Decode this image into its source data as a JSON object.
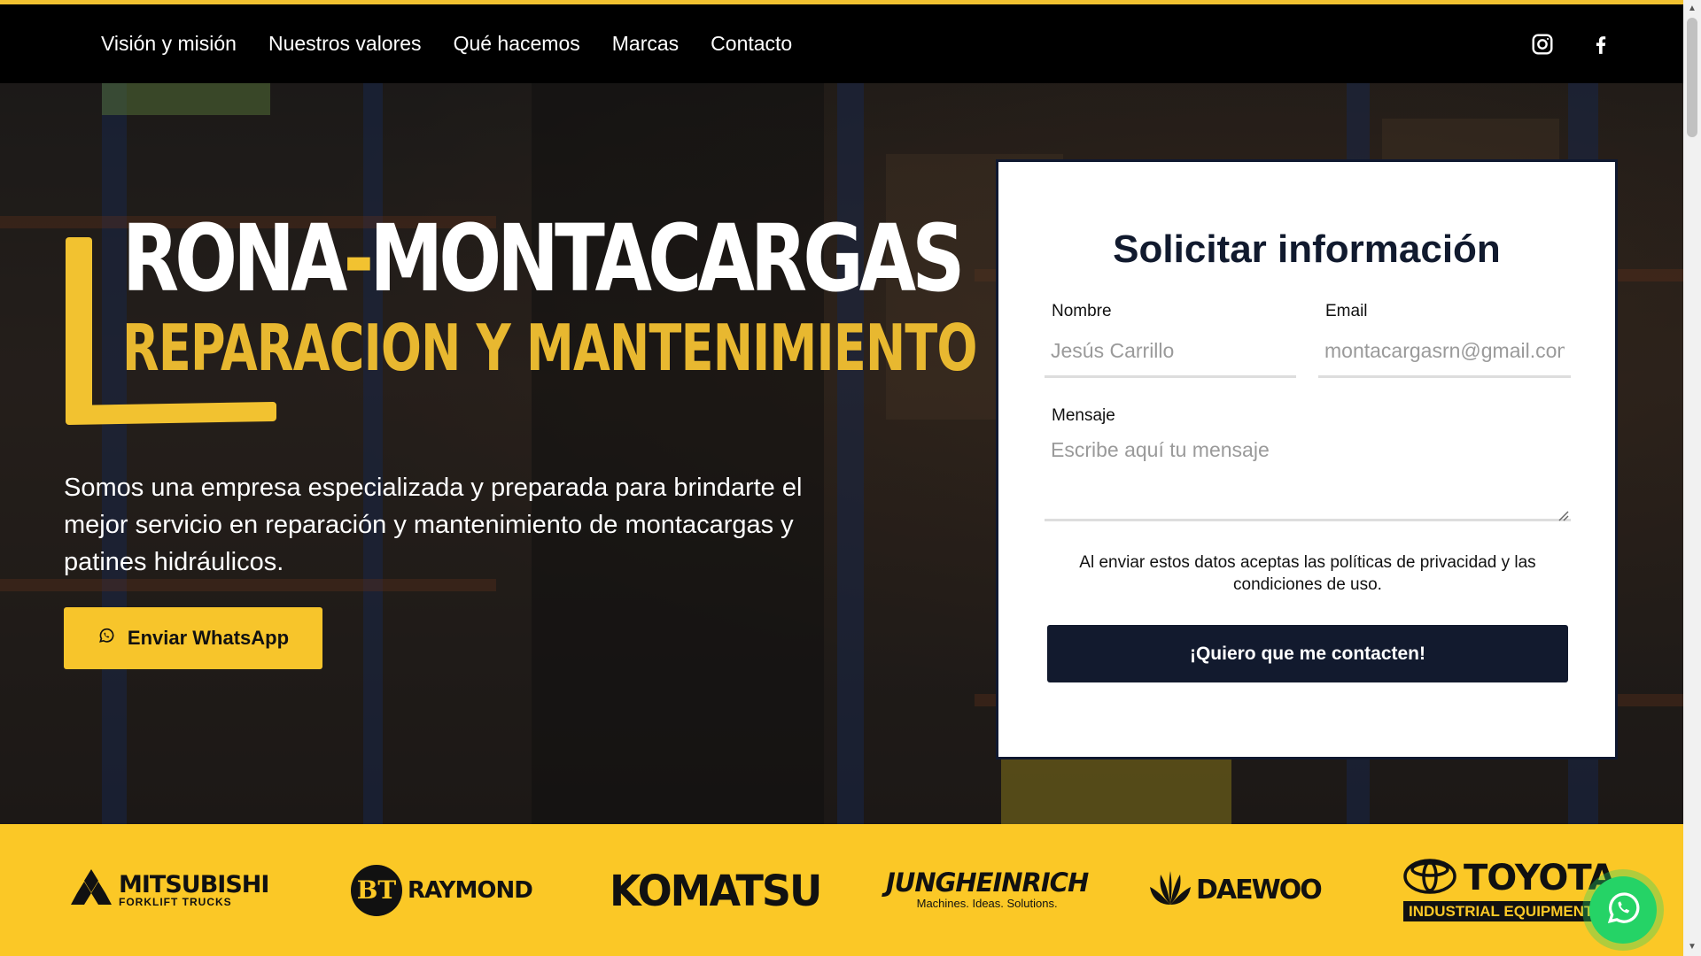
{
  "nav": {
    "items": [
      {
        "label": "Visión y misión"
      },
      {
        "label": "Nuestros valores"
      },
      {
        "label": "Qué hacemos"
      },
      {
        "label": "Marcas"
      },
      {
        "label": "Contacto"
      }
    ],
    "social": [
      "instagram-icon",
      "facebook-icon"
    ]
  },
  "hero": {
    "title_part1": "RONA",
    "title_dash": "-",
    "title_part2": "MONTACARGAS",
    "subtitle": "REPARACION Y MANTENIMIENTO",
    "description": "Somos una empresa especializada y preparada para brindarte el mejor servicio en reparación y mantenimiento de montacargas y patines hidráulicos.",
    "whatsapp_button": "Enviar WhatsApp"
  },
  "form": {
    "title": "Solicitar información",
    "name_label": "Nombre",
    "name_placeholder": "Jesús Carrillo",
    "email_label": "Email",
    "email_placeholder": "montacargasrn@gmail.com",
    "message_label": "Mensaje",
    "message_placeholder": "Escribe aquí tu mensaje",
    "privacy_text": "Al enviar estos datos aceptas las políticas de privacidad y las condiciones de uso.",
    "submit_label": "¡Quiero que me contacten!"
  },
  "brands": {
    "mitsubishi": {
      "name": "MITSUBISHI",
      "tagline": "FORKLIFT TRUCKS"
    },
    "raymond": {
      "name": "RAYMOND",
      "mark": "BT"
    },
    "komatsu": {
      "name": "KOMATSU"
    },
    "jungheinrich": {
      "name": "JUNGHEINRICH",
      "tagline": "Machines. Ideas. Solutions."
    },
    "daewoo": {
      "name": "DAEWOO"
    },
    "toyota": {
      "name": "TOYOTA",
      "tagline": "INDUSTRIAL EQUIPMENT"
    }
  },
  "colors": {
    "accent": "#f2c230",
    "navy": "#121a2e",
    "whatsapp": "#25d366"
  }
}
